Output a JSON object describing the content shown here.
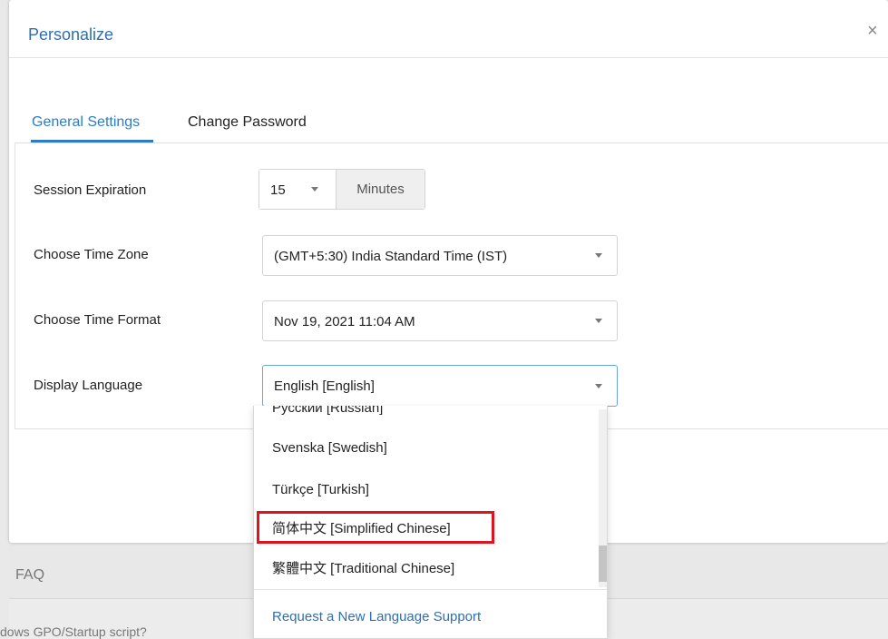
{
  "modal": {
    "title": "Personalize",
    "close_glyph": "×",
    "close_icon": "close-icon"
  },
  "tabs": [
    {
      "label": "General Settings",
      "active": true
    },
    {
      "label": "Change Password",
      "active": false
    }
  ],
  "settings": {
    "session": {
      "label": "Session Expiration",
      "value": "15",
      "unit": "Minutes"
    },
    "timezone": {
      "label": "Choose Time Zone",
      "value": "(GMT+5:30) India Standard Time (IST)"
    },
    "timeformat": {
      "label": "Choose Time Format",
      "value": "Nov 19, 2021 11:04 AM"
    },
    "language": {
      "label": "Display Language",
      "value": "English [English]"
    }
  },
  "language_dropdown": {
    "options": [
      "Русский [Russian]",
      "Svenska [Swedish]",
      "Türkçe [Turkish]",
      "简体中文 [Simplified Chinese]",
      "繁體中文 [Traditional Chinese]"
    ],
    "highlighted_option": "简体中文 [Simplified Chinese]",
    "request_link": "Request a New Language Support"
  },
  "background": {
    "faq": "FAQ",
    "script_text": "dows GPO/Startup script?"
  },
  "colors": {
    "accent": "#2f7bc4",
    "highlight": "#e0141e"
  }
}
